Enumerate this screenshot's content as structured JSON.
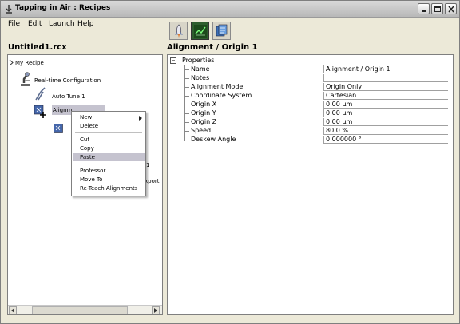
{
  "window": {
    "title": "Tapping in Air : Recipes"
  },
  "menubar": [
    "File",
    "Edit",
    "Launch",
    "Help"
  ],
  "document": {
    "filename": "Untitled1.rcx"
  },
  "tree": {
    "root": "My Recipe",
    "items": [
      "Real-time Configuration",
      "Auto Tune 1",
      "Alignm"
    ],
    "partial_labels": [
      "1",
      "xport"
    ]
  },
  "context_menu": {
    "items": [
      "New",
      "Delete",
      "Cut",
      "Copy",
      "Paste",
      "Professor",
      "Move To",
      "Re-Teach Alignments"
    ],
    "highlighted": "Paste"
  },
  "properties": {
    "panel_title": "Alignment / Origin 1",
    "group": "Properties",
    "rows": [
      {
        "name": "Name",
        "value": "Alignment / Origin 1"
      },
      {
        "name": "Notes",
        "value": ""
      },
      {
        "name": "Alignment Mode",
        "value": "Origin Only"
      },
      {
        "name": "Coordinate System",
        "value": "Cartesian"
      },
      {
        "name": "Origin X",
        "value": "0.00 µm"
      },
      {
        "name": "Origin Y",
        "value": "0.00 µm"
      },
      {
        "name": "Origin Z",
        "value": "0.00 µm"
      },
      {
        "name": "Speed",
        "value": "80.0 %"
      },
      {
        "name": "Deskew Angle",
        "value": "0.000000 °"
      }
    ]
  },
  "colors": {
    "selection": "#C5C3CF",
    "active_toolbar": "#2E5E2E"
  }
}
